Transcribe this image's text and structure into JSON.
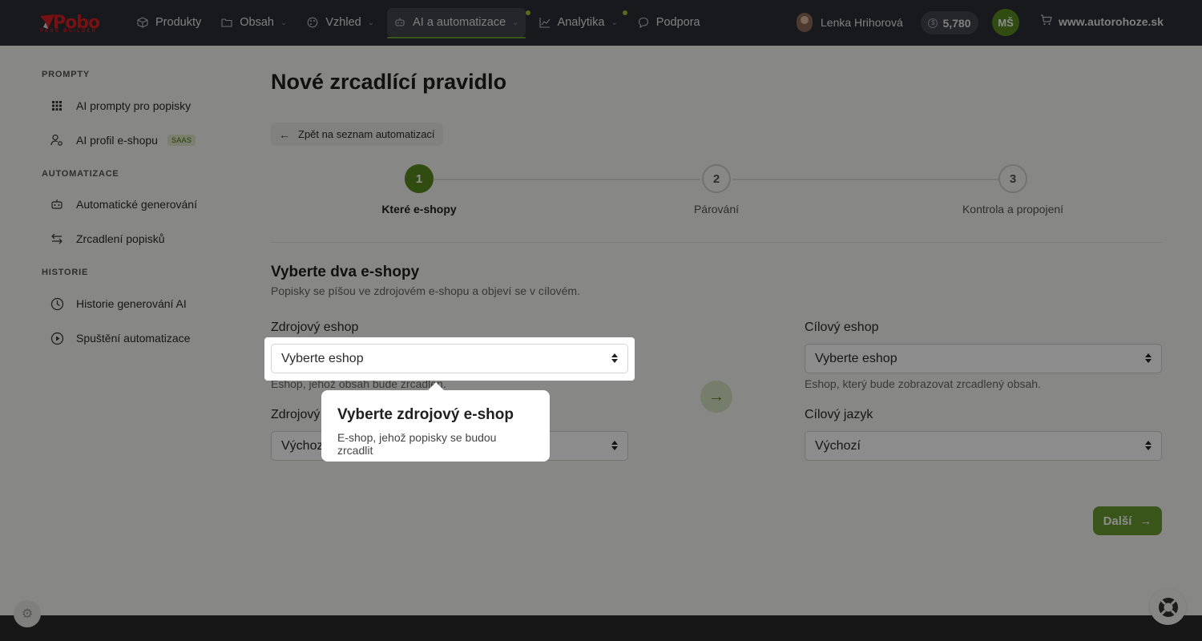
{
  "topbar": {
    "logo": {
      "word": "Pobo",
      "sub": "PAGE BUILDER"
    },
    "nav": [
      {
        "label": "Produkty",
        "icon": "box-icon",
        "has_dropdown": false
      },
      {
        "label": "Obsah",
        "icon": "folder-icon",
        "has_dropdown": true
      },
      {
        "label": "Vzhled",
        "icon": "palette-icon",
        "has_dropdown": true
      },
      {
        "label": "AI a automatizace",
        "icon": "robot-icon",
        "has_dropdown": true,
        "active": true
      },
      {
        "label": "Analytika",
        "icon": "chart-icon",
        "has_dropdown": true
      },
      {
        "label": "Podpora",
        "icon": "chat-icon",
        "has_dropdown": false
      }
    ],
    "user_name": "Lenka Hrihorová",
    "credits": "5,780",
    "avatar_initials": "MŠ",
    "shop_domain": "www.autorohoze.sk"
  },
  "sidebar": {
    "sections": [
      {
        "title": "PROMPTY",
        "items": [
          {
            "label": "AI prompty pro popisky",
            "icon": "grid-icon"
          },
          {
            "label": "AI profil e-shopu",
            "icon": "user-settings-icon",
            "badge": "SAAS"
          }
        ]
      },
      {
        "title": "AUTOMATIZACE",
        "items": [
          {
            "label": "Automatické generování",
            "icon": "robot-icon"
          },
          {
            "label": "Zrcadlení popisků",
            "icon": "swap-arrows-icon"
          }
        ]
      },
      {
        "title": "HISTORIE",
        "items": [
          {
            "label": "Historie generování AI",
            "icon": "clock-icon"
          },
          {
            "label": "Spuštění automatizace",
            "icon": "play-circle-icon"
          }
        ]
      }
    ]
  },
  "main": {
    "title": "Nové zrcadlící pravidlo",
    "back_label": "Zpět na seznam automatizací",
    "steps": [
      {
        "number": "1",
        "label": "Které e-shopy",
        "active": true
      },
      {
        "number": "2",
        "label": "Párování",
        "active": false
      },
      {
        "number": "3",
        "label": "Kontrola a propojení",
        "active": false
      }
    ],
    "section_title": "Vyberte dva e-shopy",
    "section_subtitle": "Popisky se píšou ve zdrojovém e-shopu a objeví se v cílovém.",
    "source": {
      "shop_label": "Zdrojový eshop",
      "shop_value": "Vyberte eshop",
      "shop_help": "Eshop, jehož obsah bude zrcadlen.",
      "lang_label": "Zdrojový jazyk",
      "lang_value": "Výchozí"
    },
    "target": {
      "shop_label": "Cílový eshop",
      "shop_value": "Vyberte eshop",
      "shop_help": "Eshop, který bude zobrazovat zrcadlený obsah.",
      "lang_label": "Cílový jazyk",
      "lang_value": "Výchozí"
    },
    "next_label": "Další"
  },
  "tooltip": {
    "title": "Vyberte zdrojový e-shop",
    "text": "E-shop, jehož popisky se budou zrcadlit"
  },
  "colors": {
    "brand_green": "#5a8b1e",
    "brand_red": "#d71f26",
    "topbar_bg": "#2b2f36"
  }
}
